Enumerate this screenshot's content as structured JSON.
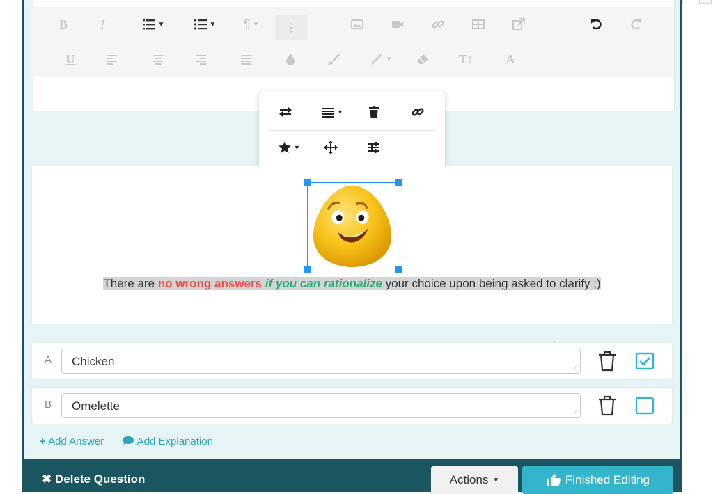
{
  "toolbar": {
    "row1": {
      "bold": "B",
      "italic": "I",
      "paragraph": "¶",
      "more": "⋮",
      "undo_icon": "undo-icon",
      "redo_icon": "redo-icon"
    },
    "row2": {
      "underline": "U",
      "font_size": "T↕",
      "font_color": "A"
    }
  },
  "image_popover": {
    "icons": [
      "replace-icon",
      "align-icon",
      "delete-icon",
      "link-icon",
      "style-icon",
      "move-icon",
      "settings-icon"
    ]
  },
  "content": {
    "caption_start": "There are ",
    "caption_red": "no wrong answers",
    "caption_space": " ",
    "caption_green": "if you can rationalize",
    "caption_end": " your choice upon being asked to clarify ;)",
    "image_name": "smiling-egg-character"
  },
  "answers": [
    {
      "letter": "A",
      "value": "Chicken",
      "correct": true
    },
    {
      "letter": "B",
      "value": "Omelette",
      "correct": false
    }
  ],
  "links": {
    "add_answer": "Add Answer",
    "add_explanation": "Add Explanation"
  },
  "footer": {
    "delete_question": "Delete Question",
    "actions": "Actions",
    "finished_editing": "Finished Editing"
  },
  "colors": {
    "accent": "#35b5cb",
    "footer": "#1b5560",
    "red_text": "#f04b4b",
    "green_text": "#2eaa7a"
  }
}
